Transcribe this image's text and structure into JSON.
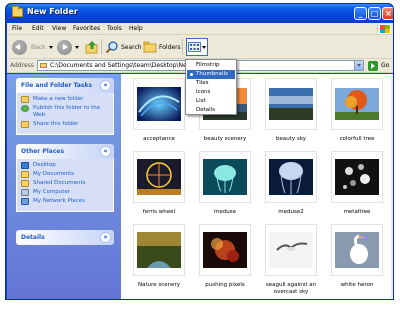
{
  "window": {
    "title": "New Folder",
    "buttons": {
      "minimize": "_",
      "maximize": "□",
      "close": "×"
    }
  },
  "menubar": [
    "File",
    "Edit",
    "View",
    "Favorites",
    "Tools",
    "Help"
  ],
  "toolbar": {
    "back": "Back",
    "search": "Search",
    "folders": "Folders"
  },
  "address": {
    "label": "Address",
    "value": "C:\\Documents and Settings\\team\\Desktop\\New Folder",
    "go": "Go"
  },
  "views_menu": {
    "items": [
      "Filmstrip",
      "Thumbnails",
      "Tiles",
      "Icons",
      "List",
      "Details"
    ],
    "selected": "Thumbnails"
  },
  "sidebar": {
    "file_tasks": {
      "title": "File and Folder Tasks",
      "items": [
        "Make a new folder",
        "Publish this folder to the Web",
        "Share this folder"
      ]
    },
    "other_places": {
      "title": "Other Places",
      "items": [
        "Desktop",
        "My Documents",
        "Shared Documents",
        "My Computer",
        "My Network Places"
      ]
    },
    "details": {
      "title": "Details"
    }
  },
  "files": [
    {
      "name": "acceptance",
      "icon": "blue-swirl-thumbnail"
    },
    {
      "name": "beauty scenery",
      "icon": "sunset-coast-thumbnail"
    },
    {
      "name": "beauty sky",
      "icon": "sky-landscape-thumbnail"
    },
    {
      "name": "colorfull tree",
      "icon": "autumn-tree-thumbnail"
    },
    {
      "name": "ferris wheel",
      "icon": "ferris-wheel-thumbnail"
    },
    {
      "name": "meduse",
      "icon": "jellyfish-thumbnail"
    },
    {
      "name": "meduse2",
      "icon": "jellyfish-thumbnail"
    },
    {
      "name": "metaltree",
      "icon": "metal-tree-thumbnail"
    },
    {
      "name": "Nature scenery",
      "icon": "forest-river-thumbnail"
    },
    {
      "name": "pushing pixels",
      "icon": "abstract-pixels-thumbnail"
    },
    {
      "name": "seagull against an overcast sky",
      "icon": "seagull-thumbnail"
    },
    {
      "name": "white heron",
      "icon": "heron-thumbnail"
    }
  ]
}
